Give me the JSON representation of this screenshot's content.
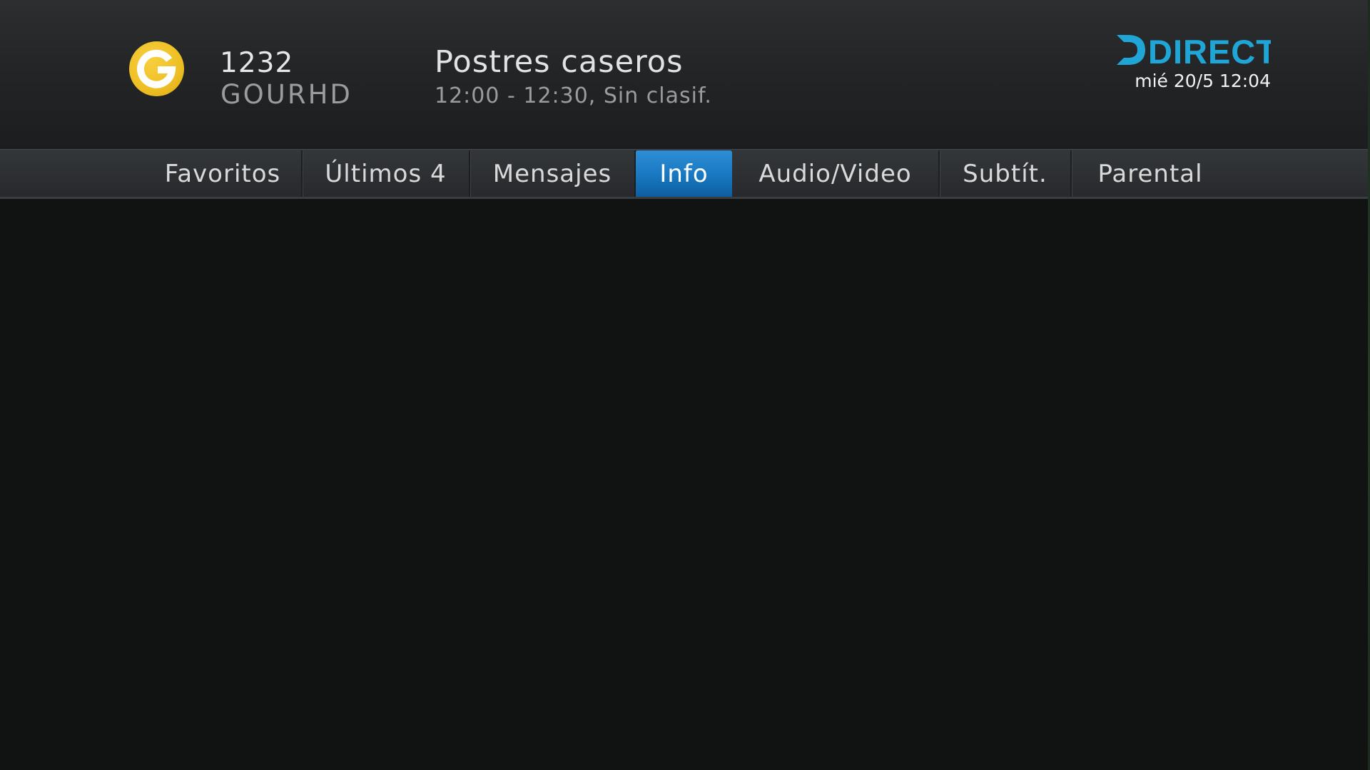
{
  "colors": {
    "accent_blue": "#1877c0",
    "brand_cyan": "#1fa6d6",
    "channel_logo_yellow": "#eebf24",
    "background": "#111212"
  },
  "channel": {
    "logo_icon": "channel-g-logo-icon",
    "number": "1232",
    "name": "GOURHD"
  },
  "program": {
    "title": "Postres caseros",
    "time_rating": "12:00 - 12:30, Sin clasif."
  },
  "brand": {
    "logo_icon": "directv-logo-icon",
    "logo_text": "DIRECTV"
  },
  "datetime": "mié 20/5 12:04",
  "menu": {
    "selected": "Info",
    "tabs": [
      {
        "label": "Favoritos"
      },
      {
        "label": "Últimos 4"
      },
      {
        "label": "Mensajes"
      },
      {
        "label": "Info"
      },
      {
        "label": "Audio/Video"
      },
      {
        "label": "Subtít."
      },
      {
        "label": "Parental"
      }
    ]
  }
}
